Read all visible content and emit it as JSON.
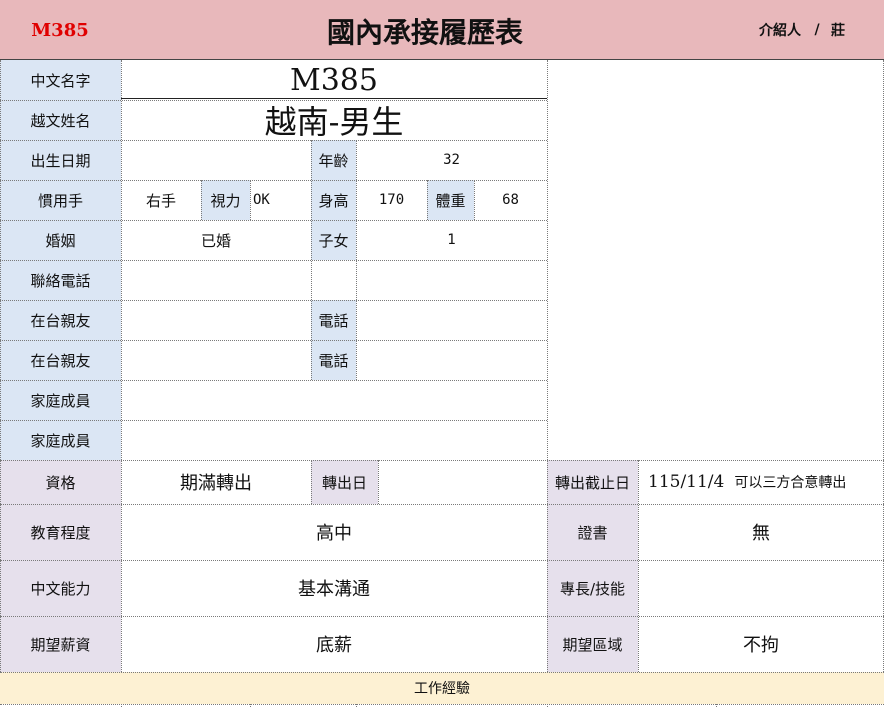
{
  "header": {
    "code": "M385",
    "title": "國內承接履歷表",
    "introducer_label": "介紹人",
    "separator": "/",
    "introducer_name": "莊"
  },
  "rows": {
    "chinese_name": {
      "label": "中文名字",
      "value": "M385"
    },
    "vietnamese_name": {
      "label": "越文姓名",
      "value": "越南-男生"
    },
    "birth": {
      "label": "出生日期",
      "value": "",
      "age_label": "年齡",
      "age_value": "32"
    },
    "handed": {
      "label": "慣用手",
      "value": "右手",
      "vision_label": "視力",
      "vision_value": "OK",
      "height_label": "身高",
      "height_value": "170",
      "weight_label": "體重",
      "weight_value": "68"
    },
    "marriage": {
      "label": "婚姻",
      "value": "已婚",
      "children_label": "子女",
      "children_value": "1"
    },
    "contact": {
      "label": "聯絡電話",
      "value": ""
    },
    "relative1": {
      "label": "在台親友",
      "value": "",
      "phone_label": "電話",
      "phone_value": ""
    },
    "relative2": {
      "label": "在台親友",
      "value": "",
      "phone_label": "電話",
      "phone_value": ""
    },
    "family1": {
      "label": "家庭成員",
      "value": ""
    },
    "family2": {
      "label": "家庭成員",
      "value": ""
    }
  },
  "lower": {
    "qualification": {
      "label": "資格",
      "value": "期滿轉出",
      "transfer_date_label": "轉出日",
      "transfer_date_value": "",
      "deadline_label": "轉出截止日",
      "deadline_value": "115/11/4",
      "deadline_note": "可以三方合意轉出"
    },
    "education": {
      "label": "教育程度",
      "value": "高中",
      "cert_label": "證書",
      "cert_value": "無"
    },
    "chinese": {
      "label": "中文能力",
      "value": "基本溝通",
      "skill_label": "專長/技能",
      "skill_value": ""
    },
    "salary": {
      "label": "期望薪資",
      "value": "底薪",
      "region_label": "期望區域",
      "region_value": "不拘"
    }
  },
  "work": {
    "label": "工作經驗"
  },
  "colors": {
    "header_bg": "#e8b8bb",
    "label_bg": "#dbe6f4",
    "label2_bg": "#e6e0ec",
    "work_bg": "#fdf1d3",
    "code_color": "#e00000"
  }
}
